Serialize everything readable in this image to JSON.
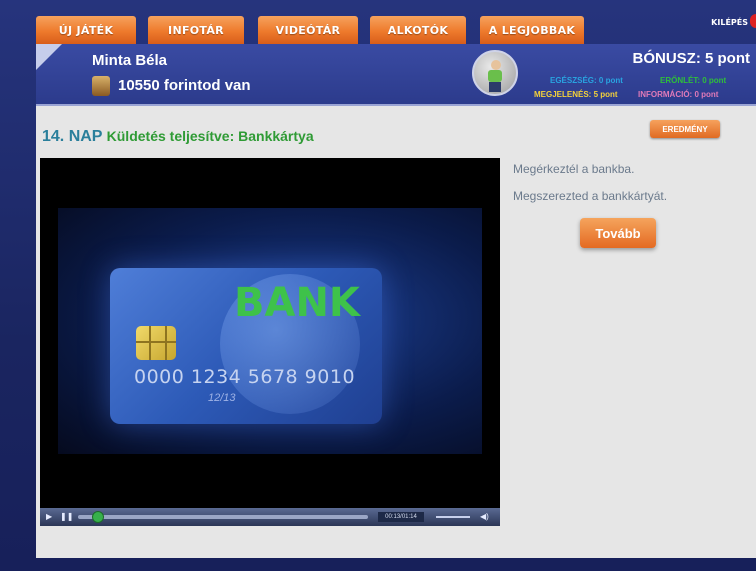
{
  "nav": {
    "items": [
      "ÚJ JÁTÉK",
      "INFOTÁR",
      "VIDEÓTÁR",
      "ALKOTÓK",
      "A LEGJOBBAK"
    ],
    "exit_label": "KILÉPÉS"
  },
  "header": {
    "player_name": "Minta Béla",
    "money": "10550 forintod van",
    "bonus": "BÓNUSZ: 5 pont",
    "stats": {
      "health": "EGÉSZSÉG: 0 pont",
      "fitness": "ERŐNLÉT: 0 pont",
      "appearance": "MEGJELENÉS: 5 pont",
      "information": "INFORMÁCIÓ: 0 pont"
    }
  },
  "mission": {
    "day": "14. NAP",
    "status": "Küldetés teljesítve: Bankkártya",
    "result_button": "EREDMÉNY"
  },
  "video": {
    "card_brand": "BANK",
    "card_number": "0000 1234 5678 9010",
    "card_expiry": "12/13",
    "time": "00:13/01:14",
    "progress": 0.07
  },
  "messages": [
    "Megérkeztél a bankba.",
    "Megszerezted a bankkártyát."
  ],
  "next_button": "Tovább",
  "colors": {
    "accent_orange": "#ee7a2c",
    "header_blue": "#2c3b8c",
    "day_blue": "#2a7f9b",
    "mission_green": "#2f9b35",
    "health": "#29a3e0",
    "fitness": "#2fbf3a",
    "appearance": "#f4d23a",
    "information": "#e07ab8"
  },
  "icons": [
    "money-bag-icon",
    "walking-avatar-icon",
    "play-icon",
    "pause-icon",
    "volume-icon"
  ]
}
